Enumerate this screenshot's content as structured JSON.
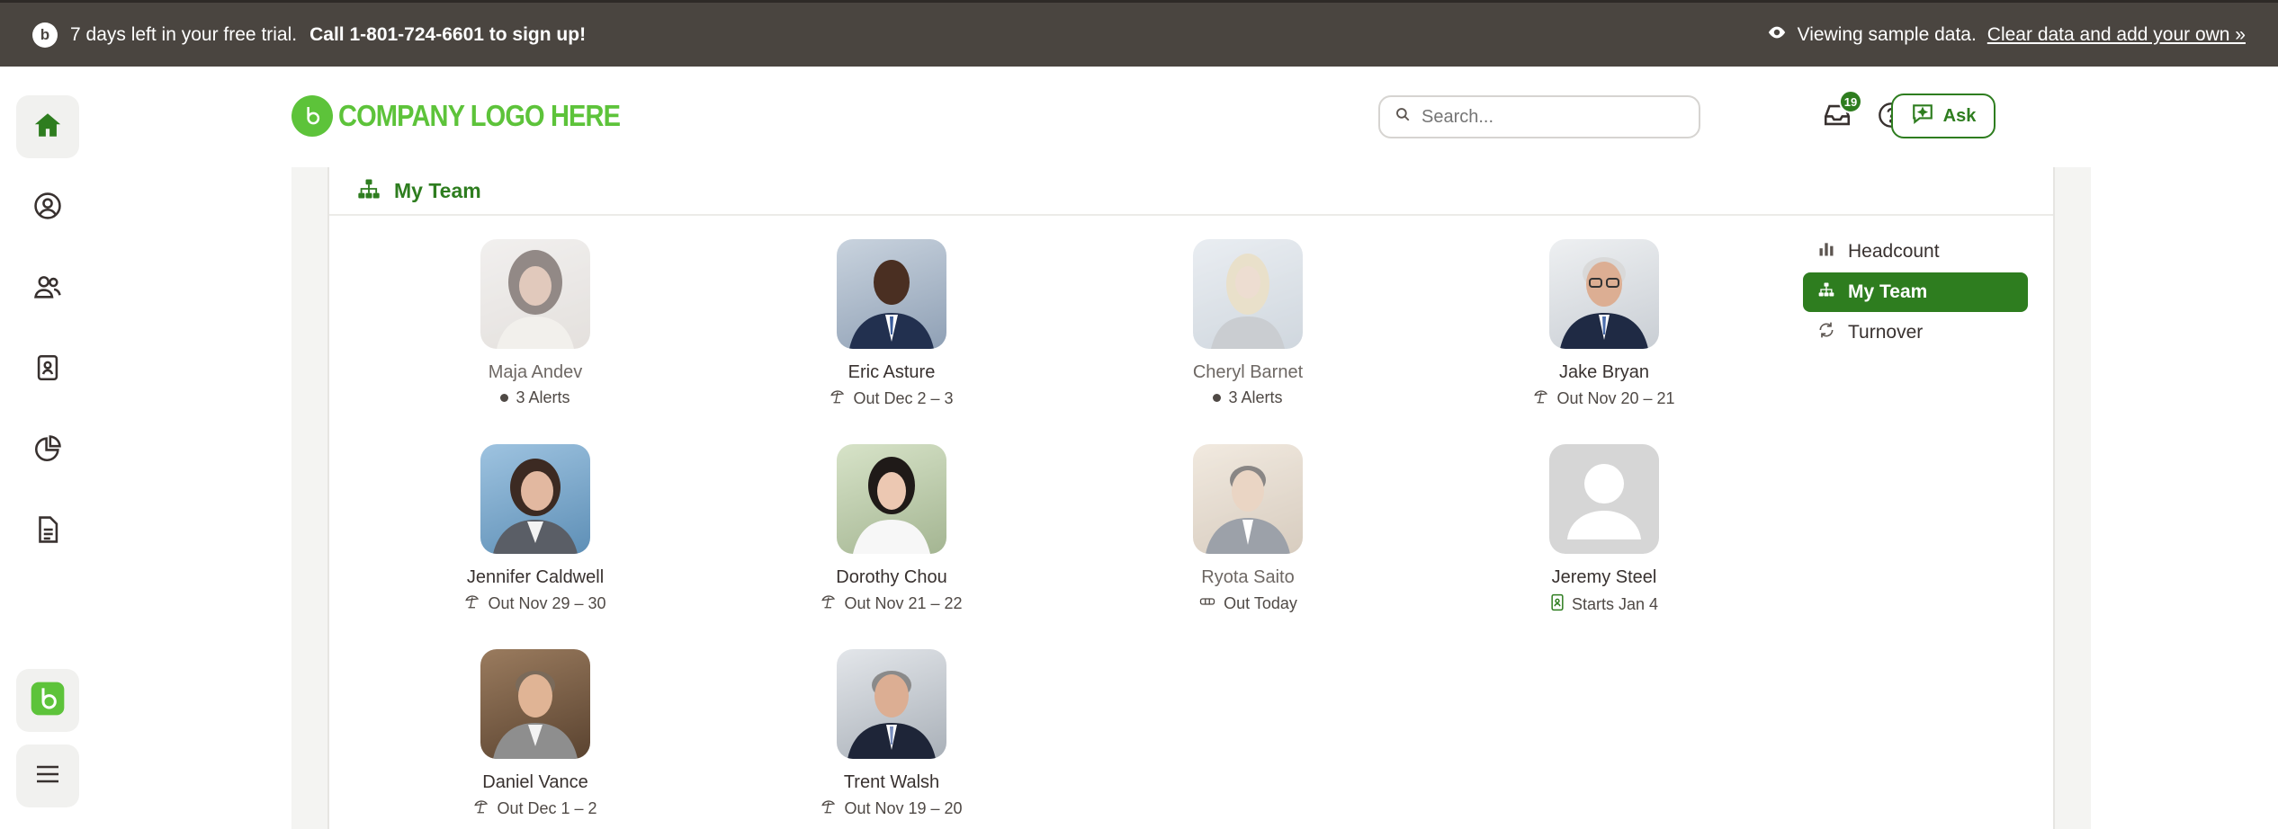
{
  "banner": {
    "trial_prefix": "7 days left in your free trial.",
    "trial_call": "Call 1-801-724-6601 to sign up!",
    "viewing_text": "Viewing sample data.",
    "clear_link": "Clear data and add your own »"
  },
  "header": {
    "logo_text": "COMPANY LOGO HERE",
    "search_placeholder": "Search...",
    "notification_count": "19",
    "ask_label": "Ask"
  },
  "card": {
    "title": "My Team"
  },
  "side_menu": [
    {
      "label": "Headcount",
      "icon": "bar-chart-icon",
      "active": false
    },
    {
      "label": "My Team",
      "icon": "org-chart-icon",
      "active": true
    },
    {
      "label": "Turnover",
      "icon": "refresh-icon",
      "active": false
    }
  ],
  "people": [
    {
      "name": "Maja Andev",
      "status": "3 Alerts",
      "status_icon": "dot-icon",
      "faded": true
    },
    {
      "name": "Eric Asture",
      "status": "Out Dec 2 – 3",
      "status_icon": "beach-umbrella-icon",
      "faded": false
    },
    {
      "name": "Cheryl Barnet",
      "status": "3 Alerts",
      "status_icon": "dot-icon",
      "faded": true
    },
    {
      "name": "Jake Bryan",
      "status": "Out Nov 20 – 21",
      "status_icon": "beach-umbrella-icon",
      "faded": false
    },
    {
      "name": "Jennifer Caldwell",
      "status": "Out Nov 29 – 30",
      "status_icon": "beach-umbrella-icon",
      "faded": false
    },
    {
      "name": "Dorothy Chou",
      "status": "Out Nov 21 – 22",
      "status_icon": "beach-umbrella-icon",
      "faded": false
    },
    {
      "name": "Ryota Saito",
      "status": "Out Today",
      "status_icon": "bandage-icon",
      "faded": true
    },
    {
      "name": "Jeremy Steel",
      "status": "Starts Jan 4",
      "status_icon": "badge-icon",
      "faded": false
    },
    {
      "name": "Daniel Vance",
      "status": "Out Dec 1 – 2",
      "status_icon": "beach-umbrella-icon",
      "faded": false
    },
    {
      "name": "Trent Walsh",
      "status": "Out Nov 19 – 20",
      "status_icon": "beach-umbrella-icon",
      "faded": false
    }
  ],
  "colors": {
    "brand_green": "#2e7d1f",
    "logo_green": "#5dc33a",
    "banner_bg": "#4a4540"
  }
}
